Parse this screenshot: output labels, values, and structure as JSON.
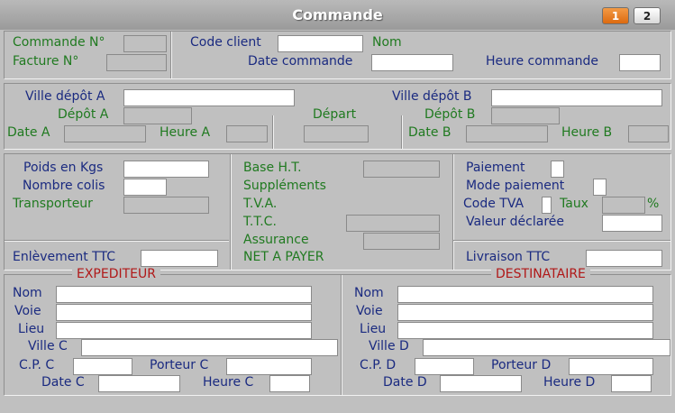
{
  "window": {
    "title": "Commande"
  },
  "pages": [
    "1",
    "2"
  ],
  "labels": {
    "commande_no": "Commande N°",
    "facture_no": "Facture N°",
    "code_client": "Code client",
    "nom": "Nom",
    "date_commande": "Date commande",
    "heure_commande": "Heure commande",
    "ville_depot_a": "Ville dépôt A",
    "depot_a": "Dépôt A",
    "depart": "Départ",
    "ville_depot_b": "Ville dépôt B",
    "depot_b": "Dépôt B",
    "date_a": "Date A",
    "heure_a": "Heure A",
    "date_b": "Date B",
    "heure_b": "Heure B",
    "poids": "Poids en Kgs",
    "nombre_colis": "Nombre colis",
    "transporteur": "Transporteur",
    "base_ht": "Base H.T.",
    "supplements": "Suppléments",
    "tva": "T.V.A.",
    "ttc": "T.T.C.",
    "assurance": "Assurance",
    "net_a_payer": "NET A PAYER",
    "paiement": "Paiement",
    "mode_paiement": "Mode paiement",
    "code_tva": "Code TVA",
    "taux": "Taux",
    "percent": "%",
    "valeur_declaree": "Valeur déclarée",
    "enlevement_ttc": "Enlèvement TTC",
    "livraison_ttc": "Livraison TTC"
  },
  "expediteur": {
    "title": "EXPEDITEUR",
    "nom": "Nom",
    "voie": "Voie",
    "lieu": "Lieu",
    "ville": "Ville C",
    "cp": "C.P. C",
    "porteur": "Porteur C",
    "date": "Date C",
    "heure": "Heure C"
  },
  "destinataire": {
    "title": "DESTINATAIRE",
    "nom": "Nom",
    "voie": "Voie",
    "lieu": "Lieu",
    "ville": "Ville D",
    "cp": "C.P. D",
    "porteur": "Porteur D",
    "date": "Date D",
    "heure": "Heure D"
  },
  "colors": {
    "accent": "#e07a1f",
    "label_blue": "#1a2a80",
    "label_green": "#207a20",
    "label_red": "#b01818"
  }
}
